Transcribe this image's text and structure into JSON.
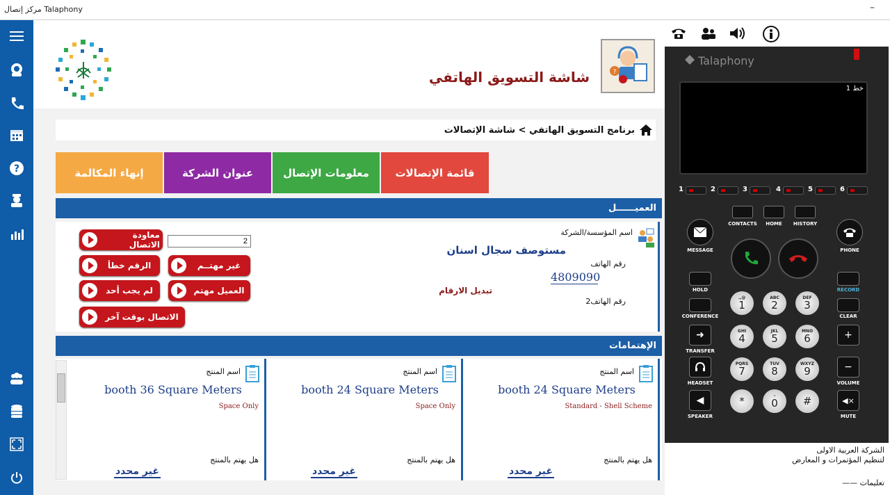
{
  "window": {
    "title": "مركز إتصال Talaphony",
    "minimize": "–"
  },
  "header": {
    "title": "شاشة التسويق الهاتفي"
  },
  "breadcrumb": {
    "text": "برنامج التسويق الهاتفي > شاشة الإتصالات"
  },
  "tabs": [
    {
      "label": "قائمة الإتصالات",
      "color": "#e2483d"
    },
    {
      "label": "معلومات الإتصال",
      "color": "#3da844"
    },
    {
      "label": "عنوان الشركة",
      "color": "#8e2aa4"
    },
    {
      "label": "إنهاء المكالمة",
      "color": "#f5a944"
    }
  ],
  "customer": {
    "section_title": "العميــــــل",
    "company_label": "اسم المؤسسة/الشركة",
    "company_name": "مستوصف سجال اسنان",
    "phone_label": "رقم الهاتف",
    "phone_value": "4809090",
    "phone2_label": "رقم الهاتف2",
    "swap_label": "تبديل الارقام",
    "counter_value": "2",
    "buttons": {
      "callback": "معاودة الاتصال",
      "wrong_number": "الرقم خطأ",
      "not_interested": "غير مهتــم",
      "no_answer": "لم يجب أحد",
      "interested": "العميل مهتم",
      "call_later": "الاتصال بوقت آخر"
    }
  },
  "interests": {
    "section_title": "الإهتمامات",
    "product_label": "اسم المنتج",
    "interest_q": "هل يهتم بالمنتج",
    "cards": [
      {
        "title": "booth 24  Square Meters",
        "subtitle": "Standard - Shell Scheme",
        "status": "غير محدد"
      },
      {
        "title": "booth 24  Square Meters",
        "subtitle": "Space Only",
        "status": "غير محدد"
      },
      {
        "title": "booth 36  Square Meters",
        "subtitle": "Space Only",
        "status": "غير محدد"
      }
    ]
  },
  "phone": {
    "brand": "Talaphony",
    "line_label": "خط 1",
    "lines": [
      "1",
      "2",
      "3",
      "4",
      "5",
      "6"
    ],
    "softkeys": {
      "contacts": "CONTACTS",
      "home": "HOME",
      "history": "HISTORY"
    },
    "labels": {
      "message": "MESSAGE",
      "phone": "PHONE",
      "hold": "HOLD",
      "record": "RECORD",
      "conference": "CONFERENCE",
      "clear": "CLEAR",
      "transfer": "TRANSFER",
      "headset": "HEADSET",
      "volume": "VOLUME",
      "speaker": "SPEAKER",
      "mute": "MUTE"
    },
    "keys": [
      {
        "d": "1",
        "s": ".,@"
      },
      {
        "d": "2",
        "s": "ABC"
      },
      {
        "d": "3",
        "s": "DEF"
      },
      {
        "d": "4",
        "s": "GHI"
      },
      {
        "d": "5",
        "s": "JKL"
      },
      {
        "d": "6",
        "s": "MNO"
      },
      {
        "d": "7",
        "s": "PQRS"
      },
      {
        "d": "8",
        "s": "TUV"
      },
      {
        "d": "9",
        "s": "WXYZ"
      },
      {
        "d": "*",
        "s": ""
      },
      {
        "d": "0",
        "s": "–"
      },
      {
        "d": "#",
        "s": ""
      }
    ]
  },
  "footer": {
    "company_line1": "الشركة العربية الاولى",
    "company_line2": "لتنظيم المؤتمرات و المعارض",
    "notes_label": "تعليمات ——"
  }
}
